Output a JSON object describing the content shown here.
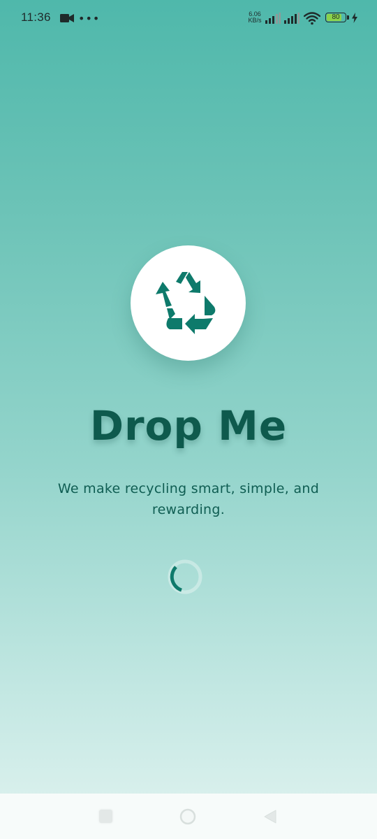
{
  "status_bar": {
    "time": "11:36",
    "more": "•••",
    "net_speed_value": "6.06",
    "net_speed_unit": "KB/s",
    "battery_level": "80",
    "battery_fraction": 0.8,
    "icons": [
      "video-icon",
      "more-icon",
      "signal-icon",
      "signal-icon",
      "wifi-icon",
      "battery-icon",
      "charging-bolt-icon"
    ]
  },
  "splash": {
    "logo_icon": "recycle-icon",
    "title": "Drop Me",
    "tagline": "We make recycling smart, simple, and rewarding.",
    "loading_indicator": "spinner"
  },
  "nav_bar": {
    "icons": [
      "recents-icon",
      "home-icon",
      "back-icon"
    ]
  },
  "colors": {
    "brand": "#0e7a6b",
    "title": "#0e5a4d",
    "background_top": "#4fb8ab",
    "background_bottom": "#e1f3f0"
  }
}
